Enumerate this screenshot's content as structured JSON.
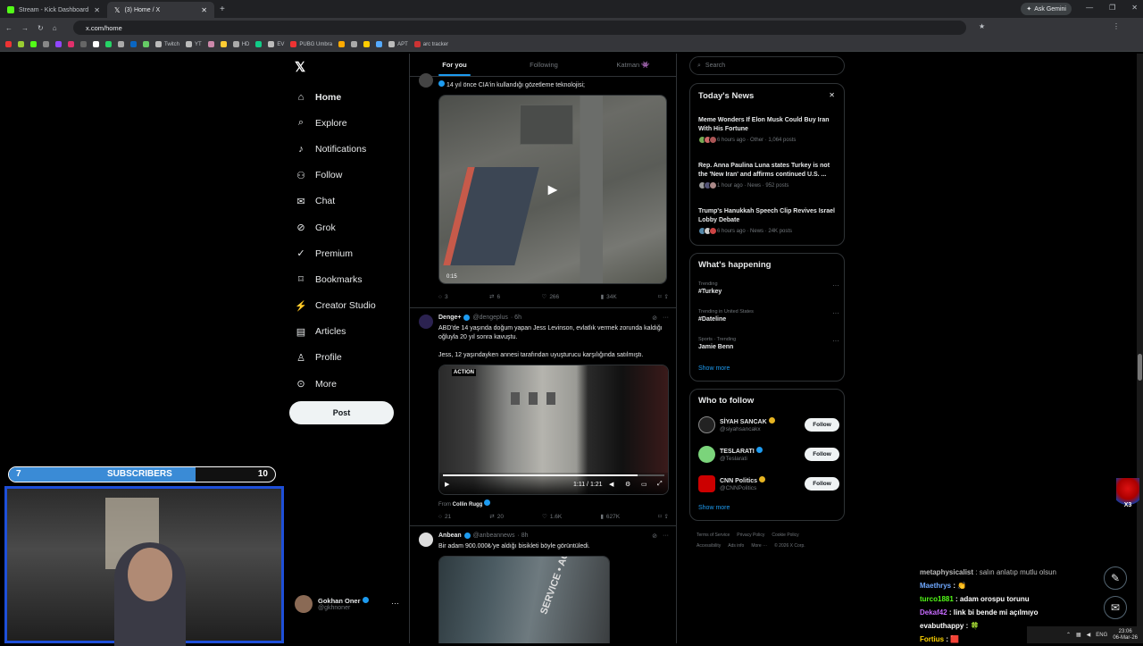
{
  "browser": {
    "tabs": [
      {
        "title": "Stream - Kick Dashboard",
        "color": "#53fc18"
      },
      {
        "title": "(3) Home / X",
        "color": "#ffffff"
      }
    ],
    "new_tab": "+",
    "ask_gemini": "Ask Gemini",
    "url": "x.com/home",
    "bookmarks": [
      "Twitch",
      "YT",
      "HD",
      "EV",
      "PUBG Umbra",
      "APT",
      "arc tracker"
    ]
  },
  "nav": {
    "logo": "𝕏",
    "items": [
      {
        "label": "Home",
        "icon": "home-icon"
      },
      {
        "label": "Explore",
        "icon": "search-icon"
      },
      {
        "label": "Notifications",
        "icon": "bell-icon"
      },
      {
        "label": "Follow",
        "icon": "person-add-icon"
      },
      {
        "label": "Chat",
        "icon": "mail-icon"
      },
      {
        "label": "Grok",
        "icon": "grok-icon"
      },
      {
        "label": "Premium",
        "icon": "verified-icon"
      },
      {
        "label": "Bookmarks",
        "icon": "bookmark-icon"
      },
      {
        "label": "Creator Studio",
        "icon": "lightning-icon"
      },
      {
        "label": "Articles",
        "icon": "article-icon"
      },
      {
        "label": "Profile",
        "icon": "person-icon"
      },
      {
        "label": "More",
        "icon": "more-icon"
      }
    ],
    "post_button": "Post",
    "account": {
      "name": "Gokhan Oner",
      "handle": "@gkhnoner",
      "more": "···"
    }
  },
  "feed": {
    "tabs": [
      "For you",
      "Following",
      "Katman 👾"
    ],
    "posts": [
      {
        "text": "14 yıl önce CIA'in kullandığı gözetleme teknolojisi;",
        "video_time": "0:15",
        "actions": {
          "replies": "3",
          "reposts": "6",
          "likes": "266",
          "views": "34K"
        }
      },
      {
        "name": "Denge+",
        "handle": "@dengeplus",
        "time": "· 6h",
        "text1": "ABD'de 14 yaşında doğum yapan Jess Levinson, evlatlık vermek zorunda kaldığı oğluyla 20 yıl sonra kavuştu.",
        "text2": "Jess, 12 yaşındayken annesi tarafından uyuşturucu karşılığında satılmıştı.",
        "video_label": "ACTION",
        "video_time": "1:11 / 1:21",
        "from_label": "From",
        "from_name": "Collin Rugg",
        "actions": {
          "replies": "21",
          "reposts": "20",
          "likes": "1.6K",
          "views": "627K"
        }
      },
      {
        "name": "Anbean",
        "handle": "@anbeannews",
        "time": "· 8h",
        "text": "Bir adam 900.000₺'ye aldığı bisikleti böyle görüntüledi.",
        "sign_text": "SERVICE • ACC"
      }
    ]
  },
  "sidebar": {
    "search_placeholder": "Search",
    "news": {
      "title": "Today's News",
      "close": "✕",
      "items": [
        {
          "title": "Meme Wonders If Elon Musk Could Buy Iran With His Fortune",
          "meta": "6 hours ago · Other · 1,064 posts"
        },
        {
          "title": "Rep. Anna Paulina Luna states Turkey is not the 'New Iran' and affirms continued U.S. ...",
          "meta": "1 hour ago · News · 952 posts"
        },
        {
          "title": "Trump's Hanukkah Speech Clip Revives Israel Lobby Debate",
          "meta": "6 hours ago · News · 24K posts"
        }
      ]
    },
    "happening": {
      "title": "What's happening",
      "trends": [
        {
          "context": "Trending",
          "name": "#Turkey"
        },
        {
          "context": "Trending in United States",
          "name": "#Dateline"
        },
        {
          "context": "Sports · Trending",
          "name": "Jamie Benn"
        }
      ],
      "show_more": "Show more"
    },
    "who_to_follow": {
      "title": "Who to follow",
      "accounts": [
        {
          "name": "SİYAH SANCAK",
          "handle": "@siyahsancakx",
          "color": "#222222"
        },
        {
          "name": "TESLARATI",
          "handle": "@Teslarati",
          "color": "#7bd47b"
        },
        {
          "name": "CNN Politics",
          "handle": "@CNNPolitics",
          "color": "#cc0000"
        }
      ],
      "follow_label": "Follow",
      "show_more": "Show more"
    },
    "footer": [
      "Terms of Service",
      "Privacy Policy",
      "Cookie Policy",
      "Accessibility",
      "Ads info",
      "More ···",
      "© 2026 X Corp."
    ]
  },
  "stream": {
    "sub_left": "7",
    "sub_label": "SUBSCRIBERS",
    "sub_right": "10",
    "sub_fraction": 0.7,
    "chat": [
      {
        "user": "metaphysicalist",
        "msg": ": salın anlatıp mutlu olsun",
        "color": "#bbbbbb"
      },
      {
        "user": "Maethrys",
        "msg": ": 👏",
        "color": "#6fa8ff"
      },
      {
        "user": "turco1881",
        "msg": ": adam orospu torunu",
        "color": "#53fc18"
      },
      {
        "user": "Dekaf42",
        "msg": ": link bi bende mi açılmıyo",
        "color": "#c86bff"
      },
      {
        "user": "evabuthappy",
        "msg": ": 🍀",
        "color": "#ffffff"
      },
      {
        "user": "Fortius",
        "msg": ": 🟥",
        "color": "#ffd400"
      }
    ],
    "overlay_badge": "X3"
  },
  "taskbar": {
    "lang": "ENG",
    "time": "23:06",
    "date": "06-Mar-26"
  }
}
